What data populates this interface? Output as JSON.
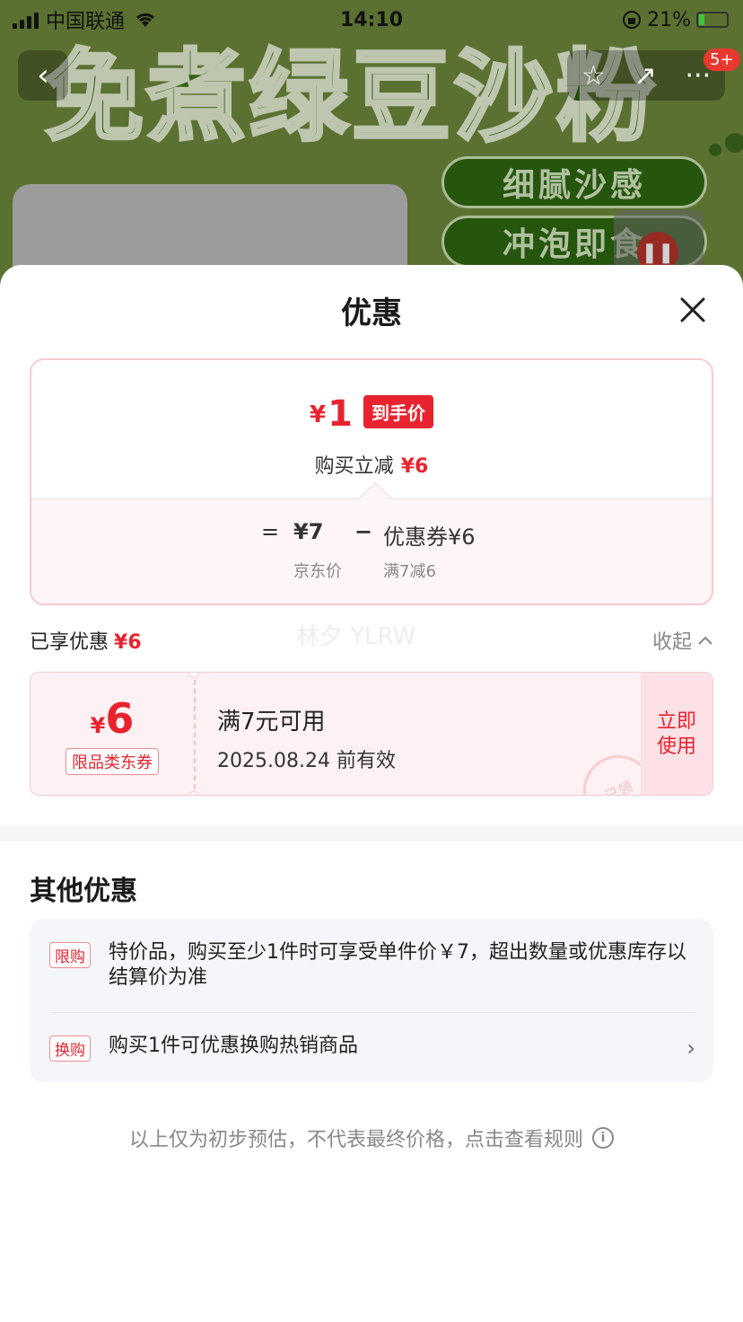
{
  "status_bar": {
    "carrier": "中国联通",
    "time": "14:10",
    "battery": "21%"
  },
  "background": {
    "hero_text": "免煮绿豆沙粉",
    "pill_1": "细腻沙感",
    "pill_2": "冲泡即食",
    "badge": "5+"
  },
  "sheet": {
    "title": "优惠",
    "price_card": {
      "currency": "¥",
      "final_price": "1",
      "tag": "到手价",
      "subtitle_label": "购买立减",
      "subtitle_value": "¥6",
      "eq_sign": "=",
      "jd_price": "¥7",
      "jd_price_label": "京东价",
      "minus_sign": "−",
      "coupon_label": "优惠券¥6",
      "coupon_sub": "满7减6"
    },
    "enjoyed": {
      "label": "已享优惠",
      "value": "¥6",
      "collapse": "收起"
    },
    "watermark": "林夕 YLRW",
    "coupon": {
      "currency": "¥",
      "amount": "6",
      "type": "限品类东券",
      "condition": "满7元可用",
      "expiry": "2025.08.24 前有效",
      "use_line1": "立即",
      "use_line2": "使用",
      "stamp": "已领"
    },
    "other": {
      "title": "其他优惠",
      "items": [
        {
          "tag": "限购",
          "text": "特价品，购买至少1件时可享受单件价￥7，超出数量或优惠库存以结算价为准"
        },
        {
          "tag": "换购",
          "text": "购买1件可优惠换购热销商品"
        }
      ]
    },
    "footnote": "以上仅为初步预估，不代表最终价格，点击查看规则"
  },
  "colors": {
    "accent": "#e8232f",
    "card_border": "#f7c9cf"
  }
}
